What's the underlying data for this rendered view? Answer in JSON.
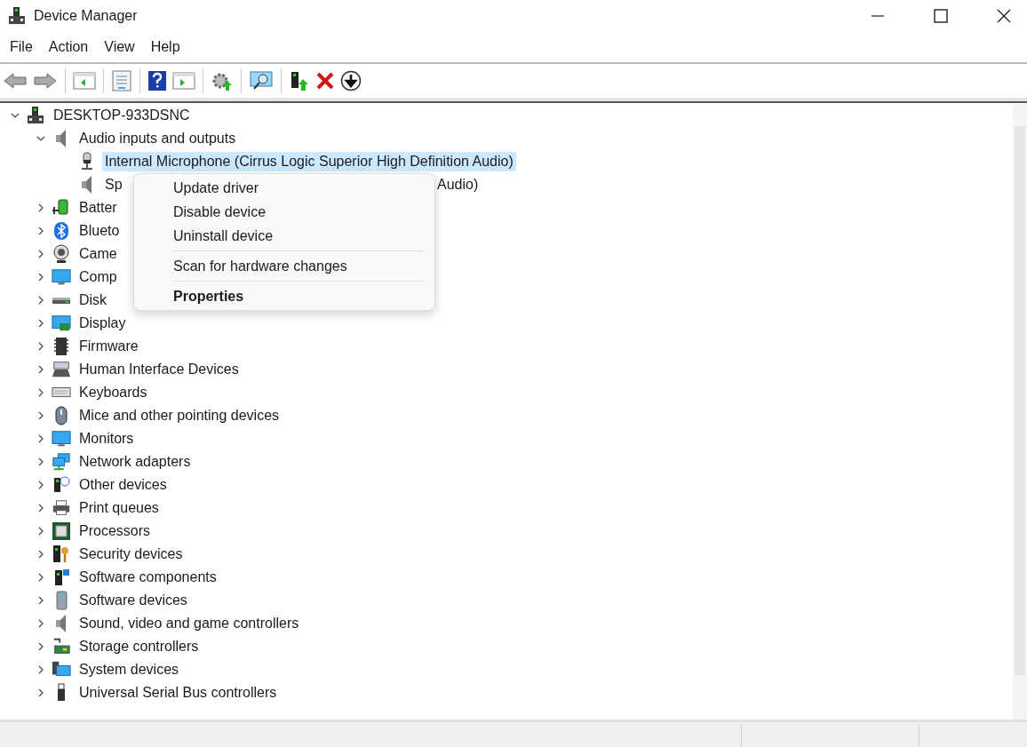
{
  "window": {
    "title": "Device Manager"
  },
  "menu_bar": [
    "File",
    "Action",
    "View",
    "Help"
  ],
  "tree": {
    "label": "DESKTOP-933DSNC",
    "expanded": true,
    "selected": false,
    "children": [
      {
        "label": "Audio inputs and outputs",
        "expanded": true,
        "selected": false,
        "children": [
          {
            "label": "Internal Microphone (Cirrus Logic Superior High Definition Audio)",
            "selected": true
          },
          {
            "label": "Sp",
            "label_end": "Audio)",
            "selected": false
          }
        ]
      },
      {
        "label": "Batter",
        "expanded": false,
        "selected": false
      },
      {
        "label": "Blueto",
        "expanded": false,
        "selected": false
      },
      {
        "label": "Came",
        "expanded": false,
        "selected": false
      },
      {
        "label": "Comp",
        "expanded": false,
        "selected": false
      },
      {
        "label": "Disk",
        "expanded": false,
        "selected": false
      },
      {
        "label": "Display",
        "expanded": false,
        "selected": false
      },
      {
        "label": "Firmware",
        "expanded": false,
        "selected": false
      },
      {
        "label": "Human Interface Devices",
        "expanded": false,
        "selected": false
      },
      {
        "label": "Keyboards",
        "expanded": false,
        "selected": false
      },
      {
        "label": "Mice and other pointing devices",
        "expanded": false,
        "selected": false
      },
      {
        "label": "Monitors",
        "expanded": false,
        "selected": false
      },
      {
        "label": "Network adapters",
        "expanded": false,
        "selected": false
      },
      {
        "label": "Other devices",
        "expanded": false,
        "selected": false
      },
      {
        "label": "Print queues",
        "expanded": false,
        "selected": false
      },
      {
        "label": "Processors",
        "expanded": false,
        "selected": false
      },
      {
        "label": "Security devices",
        "expanded": false,
        "selected": false
      },
      {
        "label": "Software components",
        "expanded": false,
        "selected": false
      },
      {
        "label": "Software devices",
        "expanded": false,
        "selected": false
      },
      {
        "label": "Sound, video and game controllers",
        "expanded": false,
        "selected": false
      },
      {
        "label": "Storage controllers",
        "expanded": false,
        "selected": false
      },
      {
        "label": "System devices",
        "expanded": false,
        "selected": false
      },
      {
        "label": "Universal Serial Bus controllers",
        "expanded": false,
        "selected": false
      }
    ]
  },
  "context_menu": [
    {
      "kind": "item",
      "label": "Update driver",
      "default": false
    },
    {
      "kind": "item",
      "label": "Disable device",
      "default": false
    },
    {
      "kind": "item",
      "label": "Uninstall device",
      "default": false
    },
    {
      "kind": "separator"
    },
    {
      "kind": "item",
      "label": "Scan for hardware changes",
      "default": false
    },
    {
      "kind": "separator"
    },
    {
      "kind": "item",
      "label": "Properties",
      "default": true
    }
  ]
}
